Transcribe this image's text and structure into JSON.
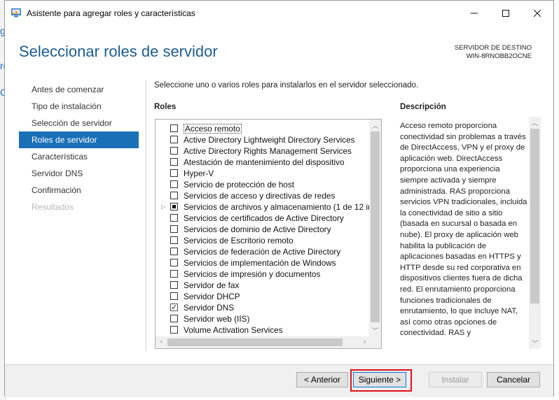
{
  "window": {
    "title": "Asistente para agregar roles y características",
    "controls": {
      "minimize": "minimize-icon",
      "maximize": "maximize-icon",
      "close": "close-icon"
    }
  },
  "page": {
    "title": "Seleccionar roles de servidor",
    "destination_label": "SERVIDOR DE DESTINO",
    "destination_name": "WIN-8RNOBB2OCNE"
  },
  "nav": {
    "items": [
      {
        "label": "Antes de comenzar",
        "state": "normal"
      },
      {
        "label": "Tipo de instalación",
        "state": "normal"
      },
      {
        "label": "Selección de servidor",
        "state": "normal"
      },
      {
        "label": "Roles de servidor",
        "state": "selected"
      },
      {
        "label": "Características",
        "state": "normal"
      },
      {
        "label": "Servidor DNS",
        "state": "normal"
      },
      {
        "label": "Confirmación",
        "state": "normal"
      },
      {
        "label": "Resultados",
        "state": "disabled"
      }
    ]
  },
  "main": {
    "instruction": "Seleccione uno o varios roles para instalarlos en el servidor seleccionado.",
    "roles_header": "Roles",
    "description_header": "Descripción",
    "roles": [
      {
        "label": "Acceso remoto",
        "state": "unchecked",
        "focused": true
      },
      {
        "label": "Active Directory Lightweight Directory Services",
        "state": "unchecked"
      },
      {
        "label": "Active Directory Rights Management Services",
        "state": "unchecked"
      },
      {
        "label": "Atestación de mantenimiento del dispositivo",
        "state": "unchecked"
      },
      {
        "label": "Hyper-V",
        "state": "unchecked"
      },
      {
        "label": "Servicio de protección de host",
        "state": "unchecked"
      },
      {
        "label": "Servicios de acceso y directivas de redes",
        "state": "unchecked"
      },
      {
        "label": "Servicios de archivos y almacenamiento (1 de 12 in",
        "state": "partial",
        "expandable": true
      },
      {
        "label": "Servicios de certificados de Active Directory",
        "state": "unchecked"
      },
      {
        "label": "Servicios de dominio de Active Directory",
        "state": "unchecked"
      },
      {
        "label": "Servicios de Escritorio remoto",
        "state": "unchecked"
      },
      {
        "label": "Servicios de federación de Active Directory",
        "state": "unchecked"
      },
      {
        "label": "Servicios de implementación de Windows",
        "state": "unchecked"
      },
      {
        "label": "Servicios de impresión y documentos",
        "state": "unchecked"
      },
      {
        "label": "Servidor de fax",
        "state": "unchecked"
      },
      {
        "label": "Servidor DHCP",
        "state": "unchecked"
      },
      {
        "label": "Servidor DNS",
        "state": "checked"
      },
      {
        "label": "Servidor web (IIS)",
        "state": "unchecked"
      },
      {
        "label": "Volume Activation Services",
        "state": "unchecked"
      }
    ],
    "description": "Acceso remoto proporciona conectividad sin problemas a través de DirectAccess, VPN y el proxy de aplicación web. DirectAccess proporciona una experiencia siempre activada y siempre administrada. RAS proporciona servicios VPN tradicionales, incluida la conectividad de sitio a sitio (basada en sucursal o basada en nube). El proxy de aplicación web habilita la publicación de aplicaciones basadas en HTTPS y HTTP desde su red corporativa en dispositivos clientes fuera de dicha red. El enrutamiento proporciona funciones tradicionales de enrutamiento, lo que incluye NAT, así como otras opciones de conectividad. RAS y"
  },
  "footer": {
    "previous": "< Anterior",
    "next": "Siguiente >",
    "install": "Instalar",
    "cancel": "Cancelar"
  },
  "colors": {
    "accent": "#1a70b7",
    "title": "#1d5c8f",
    "highlight": "#e0101a"
  }
}
